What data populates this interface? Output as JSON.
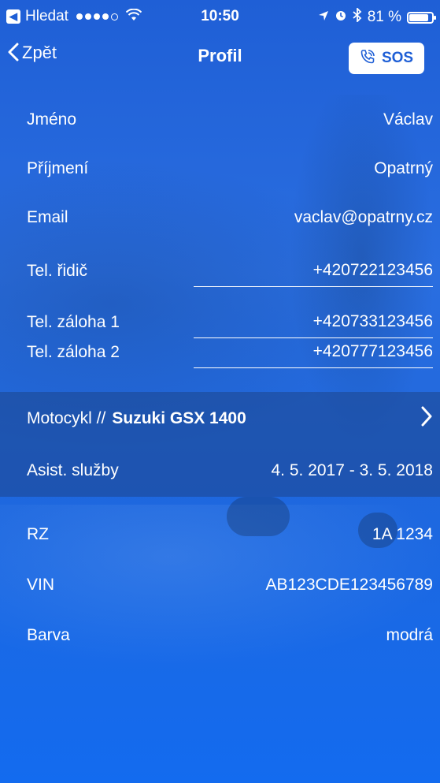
{
  "status_bar": {
    "back_app_label": "Hledat",
    "time": "10:50",
    "battery_percent": "81 %",
    "battery_level": 0.81
  },
  "nav": {
    "back_label": "Zpět",
    "title": "Profil",
    "sos_label": "SOS"
  },
  "profile": {
    "first_name": {
      "label": "Jméno",
      "value": "Václav"
    },
    "last_name": {
      "label": "Příjmení",
      "value": "Opatrný"
    },
    "email": {
      "label": "Email",
      "value": "vaclav@opatrny.cz"
    },
    "tel_driver": {
      "label": "Tel. řidič",
      "value": "+420722123456"
    },
    "tel_backup_1": {
      "label": "Tel. záloha 1",
      "value": "+420733123456"
    },
    "tel_backup_2": {
      "label": "Tel. záloha 2",
      "value": "+420777123456"
    }
  },
  "motorcycle": {
    "prefix": "Motocykl //",
    "model": "Suzuki GSX 1400",
    "assist_label": "Asist. služby",
    "assist_value": "4. 5. 2017 - 3. 5. 2018"
  },
  "vehicle": {
    "rz": {
      "label": "RZ",
      "value": "1A 1234"
    },
    "vin": {
      "label": "VIN",
      "value": "AB123CDE123456789"
    },
    "color": {
      "label": "Barva",
      "value": "modrá"
    }
  },
  "icons": {
    "back": "chevron-left-icon",
    "sos": "phone-icon",
    "arrow": "chevron-right-icon",
    "wifi": "wifi-icon",
    "location": "location-arrow-icon",
    "alarm": "alarm-icon",
    "bluetooth": "bluetooth-icon",
    "battery": "battery-icon"
  }
}
